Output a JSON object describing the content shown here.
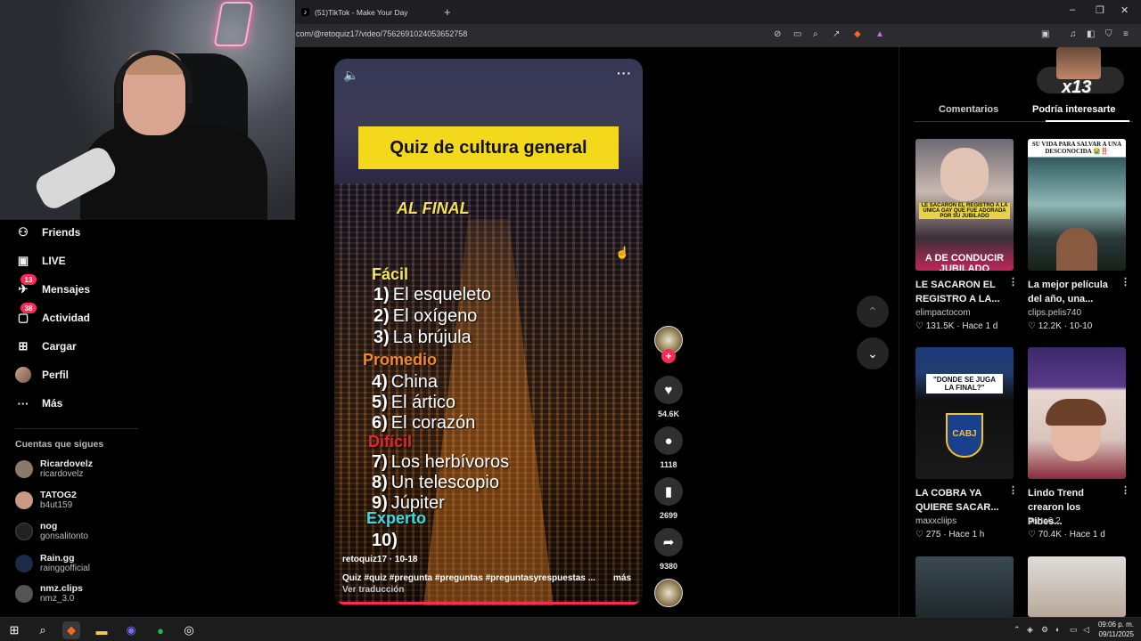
{
  "browser": {
    "tab_title": "(51)TikTok - Make Your Day",
    "url": "com/@retoquiz17/video/7562691024053652758",
    "new_tab": "+",
    "window_controls": [
      "–",
      "❐",
      "✕"
    ]
  },
  "sidebar": {
    "items": [
      {
        "label": "Friends",
        "icon": "friends-icon",
        "badge": ""
      },
      {
        "label": "LIVE",
        "icon": "live-icon",
        "badge": ""
      },
      {
        "label": "Mensajes",
        "icon": "messages-icon",
        "badge": "13"
      },
      {
        "label": "Actividad",
        "icon": "activity-icon",
        "badge": "38"
      },
      {
        "label": "Cargar",
        "icon": "upload-icon",
        "badge": ""
      },
      {
        "label": "Perfil",
        "icon": "profile-avatar",
        "badge": ""
      },
      {
        "label": "Más",
        "icon": "more-icon",
        "badge": ""
      }
    ],
    "following_title": "Cuentas que sigues",
    "following": [
      {
        "name": "Ricardovelz",
        "handle": "ricardovelz",
        "color": "#8a7a6a"
      },
      {
        "name": "TATOG2",
        "handle": "b4ut159",
        "color": "#c89a86"
      },
      {
        "name": "nog",
        "handle": "gonsalitonto",
        "color": "#222222"
      },
      {
        "name": "Rain.gg",
        "handle": "rainggofficial",
        "color": "#1d2a4a"
      },
      {
        "name": "nmz.clips",
        "handle": "nmz_3.0",
        "color": "#555555"
      }
    ]
  },
  "video": {
    "banner": "Quiz de cultura general",
    "overlay_title": "AL FINAL",
    "levels": [
      {
        "name": "Fácil",
        "color": "#f6e85a",
        "answers": [
          [
            "1)",
            "El esqueleto"
          ],
          [
            "2)",
            "El oxígeno"
          ],
          [
            "3)",
            "La brújula"
          ]
        ]
      },
      {
        "name": "Promedio",
        "color": "#f08a2a",
        "answers": [
          [
            "4)",
            "China"
          ],
          [
            "5)",
            "El ártico"
          ],
          [
            "6)",
            "El corazón"
          ]
        ]
      },
      {
        "name": "Difícil",
        "color": "#e2262e",
        "answers": [
          [
            "7)",
            "Los herbívoros"
          ],
          [
            "8)",
            "Un telescopio"
          ],
          [
            "9)",
            "Júpiter"
          ]
        ]
      },
      {
        "name": "Experto",
        "color": "#3fd9e0",
        "answers": [
          [
            "10)",
            ""
          ]
        ]
      }
    ],
    "author_date": "retoquiz17 · 10-18",
    "caption": "Quiz #quiz #pregunta #preguntas #preguntasyrespuestas ...",
    "more": "más",
    "translate": "Ver traducción"
  },
  "actions": {
    "likes": "54.6K",
    "comments": "1118",
    "saves": "2699",
    "shares": "9380"
  },
  "right_panel": {
    "overlay_counter": "x13",
    "tabs": [
      "Comentarios",
      "Podría interesarte"
    ],
    "active_tab": 1,
    "cards": [
      {
        "title": "LE SACARON EL REGISTRO A LA...",
        "user": "elimpactocom",
        "likes": "131.5K",
        "time": "Hace 1 d",
        "thumb_text": "A DE CONDUCIR JUBILADO",
        "thumb_sub": "LE SACARON EL REGISTRO A LA ÚNICA GAY QUE FUE ADORADA POR SU JUBILADO"
      },
      {
        "title": "La mejor película del año, una...",
        "user": "clips.pelis740",
        "likes": "12.2K",
        "time": "10-10",
        "thumb_text": "SU VIDA PARA SALVAR A UNA DESCONOCIDA 😭‼️",
        "thumb_sub": ""
      },
      {
        "title": "LA COBRA YA QUIERE SACAR...",
        "user": "maxxcliips",
        "likes": "275",
        "time": "Hace 1 h",
        "thumb_text": "\"DONDE SE JUGA LA FINAL?\"",
        "thumb_sub": "CABJ"
      },
      {
        "title": "Lindo Trend crearon los Pibes...",
        "user": "barto0.2",
        "likes": "70.4K",
        "time": "Hace 1 d",
        "thumb_text": "",
        "thumb_sub": ""
      }
    ]
  },
  "taskbar": {
    "time": "09:06 p. m.",
    "date": "09/11/2025"
  }
}
